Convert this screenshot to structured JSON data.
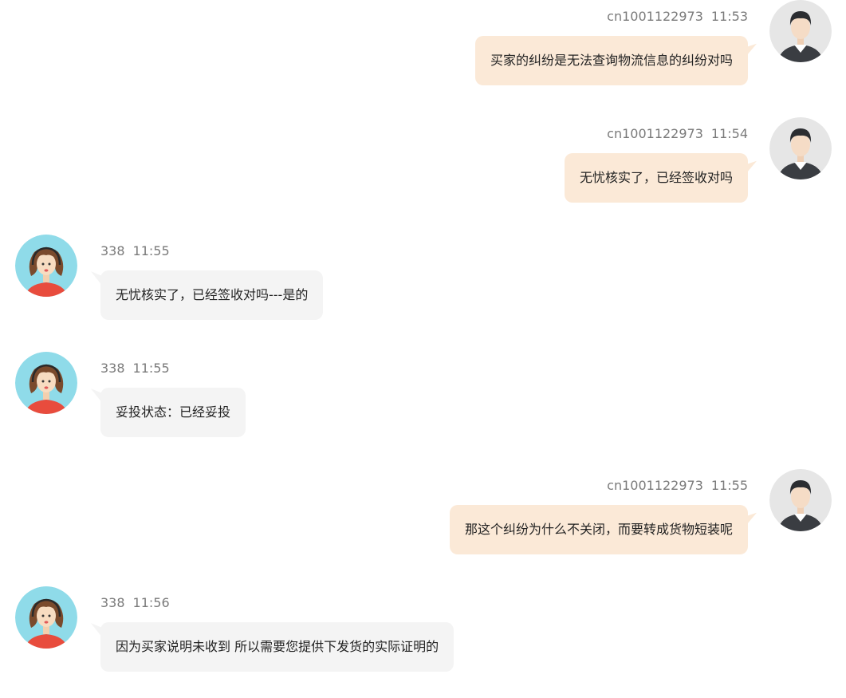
{
  "colors": {
    "own_bubble": "#fbe9d7",
    "agent_bubble": "#f4f4f4",
    "meta_text": "#7a7a7a",
    "message_text": "#222222"
  },
  "messages": [
    {
      "side": "right",
      "avatar": "male-user-avatar-icon",
      "sender": "cn1001122973",
      "time": "11:53",
      "text": "买家的纠纷是无法查询物流信息的纠纷对吗"
    },
    {
      "side": "right",
      "avatar": "male-user-avatar-icon",
      "sender": "cn1001122973",
      "time": "11:54",
      "text": "无忧核实了，已经签收对吗"
    },
    {
      "side": "left",
      "avatar": "support-agent-avatar-icon",
      "sender": "338",
      "time": "11:55",
      "text": "无忧核实了，已经签收对吗---是的"
    },
    {
      "side": "left",
      "avatar": "support-agent-avatar-icon",
      "sender": "338",
      "time": "11:55",
      "text": "妥投状态：已经妥投"
    },
    {
      "side": "right",
      "avatar": "male-user-avatar-icon",
      "sender": "cn1001122973",
      "time": "11:55",
      "text": "那这个纠纷为什么不关闭，而要转成货物短装呢"
    },
    {
      "side": "left",
      "avatar": "support-agent-avatar-icon",
      "sender": "338",
      "time": "11:56",
      "text": "因为买家说明未收到 所以需要您提供下发货的实际证明的"
    }
  ]
}
